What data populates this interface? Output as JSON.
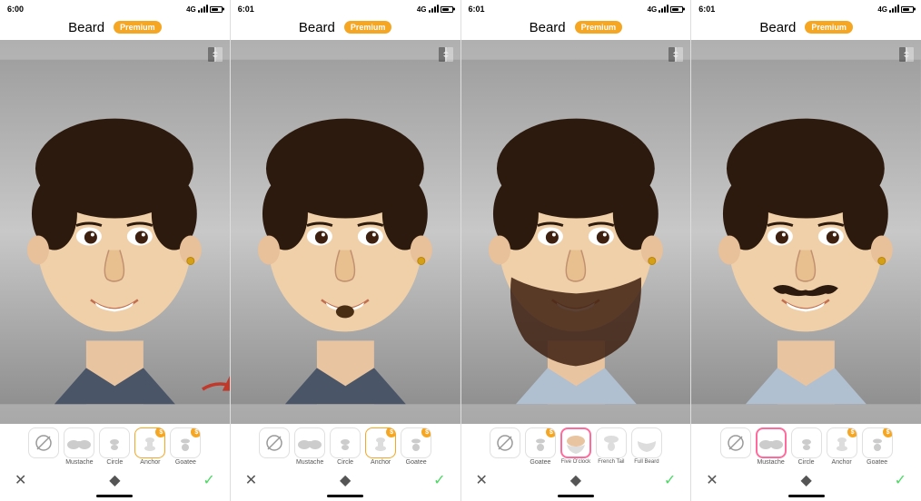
{
  "phones": [
    {
      "id": "phone1",
      "status_time": "6:00",
      "status_signal": "4G",
      "title": "Beard",
      "premium_label": "Premium",
      "has_arrow": true,
      "face_variant": "clean",
      "tools": [
        {
          "label": "",
          "icon": "no",
          "active": false,
          "badge": false
        },
        {
          "label": "Mustache",
          "icon": "mustache",
          "active": false,
          "badge": false
        },
        {
          "label": "Circle",
          "icon": "circle-beard",
          "active": false,
          "badge": false
        },
        {
          "label": "Anchor",
          "icon": "anchor-beard",
          "active": true,
          "badge": true
        },
        {
          "label": "Goatee",
          "icon": "goatee",
          "active": false,
          "badge": true
        }
      ],
      "actions": [
        "✕",
        "◆",
        "✓"
      ]
    },
    {
      "id": "phone2",
      "status_time": "6:01",
      "status_signal": "4G",
      "title": "Beard",
      "premium_label": "Premium",
      "has_arrow": false,
      "face_variant": "soul-patch",
      "tools": [
        {
          "label": "",
          "icon": "no",
          "active": false,
          "badge": false
        },
        {
          "label": "Mustache",
          "icon": "mustache",
          "active": false,
          "badge": false
        },
        {
          "label": "Circle",
          "icon": "circle-beard",
          "active": false,
          "badge": false
        },
        {
          "label": "Anchor",
          "icon": "anchor-beard",
          "active": true,
          "badge": true
        },
        {
          "label": "Goatee",
          "icon": "goatee",
          "active": false,
          "badge": true
        }
      ],
      "actions": [
        "✕",
        "◆",
        "✓"
      ]
    },
    {
      "id": "phone3",
      "status_time": "6:01",
      "status_signal": "4G",
      "title": "Beard",
      "premium_label": "Premium",
      "has_arrow": false,
      "face_variant": "full-beard",
      "tools": [
        {
          "label": "",
          "icon": "no",
          "active": false,
          "badge": false
        },
        {
          "label": "Goatee",
          "icon": "goatee",
          "active": false,
          "badge": true
        },
        {
          "label": "Five O'clock",
          "icon": "five-oclock",
          "active": true,
          "badge": false,
          "pink": true
        },
        {
          "label": "French Tail",
          "icon": "french-tail",
          "active": false,
          "badge": false
        },
        {
          "label": "Full Beard",
          "icon": "full-beard",
          "active": false,
          "badge": false
        }
      ],
      "actions": [
        "✕",
        "◆",
        "✓"
      ]
    },
    {
      "id": "phone4",
      "status_time": "6:01",
      "status_signal": "4G",
      "title": "Beard",
      "premium_label": "Premium",
      "has_arrow": false,
      "face_variant": "mustache-only",
      "tools": [
        {
          "label": "",
          "icon": "no",
          "active": false,
          "badge": false
        },
        {
          "label": "Mustache",
          "icon": "mustache",
          "active": true,
          "badge": false,
          "pink": true
        },
        {
          "label": "Circle",
          "icon": "circle-beard",
          "active": false,
          "badge": false
        },
        {
          "label": "Anchor",
          "icon": "anchor-beard",
          "active": false,
          "badge": true
        },
        {
          "label": "Goatee",
          "icon": "goatee",
          "active": false,
          "badge": true
        }
      ],
      "actions": [
        "✕",
        "◆",
        "✓"
      ]
    }
  ],
  "icons": {
    "compare": "⊞",
    "no_beard": "⊘",
    "arrow_right": "→"
  }
}
